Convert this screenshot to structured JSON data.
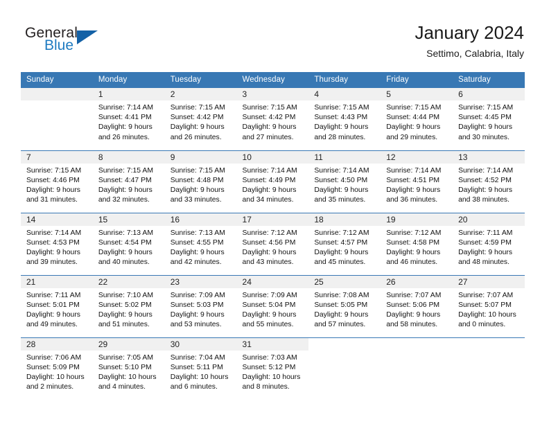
{
  "brand": {
    "name_part1": "General",
    "name_part2": "Blue",
    "flag_icon": "triangle-flag-icon",
    "accent_color": "#1f7bc1",
    "flag_color": "#1461a6"
  },
  "header": {
    "title": "January 2024",
    "subtitle": "Settimo, Calabria, Italy"
  },
  "calendar": {
    "header_bg": "#3878b4",
    "daynum_bg": "#f0f0f0",
    "weekdays": [
      "Sunday",
      "Monday",
      "Tuesday",
      "Wednesday",
      "Thursday",
      "Friday",
      "Saturday"
    ],
    "weeks": [
      [
        {
          "day": "",
          "sunrise": "",
          "sunset": "",
          "daylight_line1": "",
          "daylight_line2": "",
          "empty": true
        },
        {
          "day": "1",
          "sunrise": "Sunrise: 7:14 AM",
          "sunset": "Sunset: 4:41 PM",
          "daylight_line1": "Daylight: 9 hours",
          "daylight_line2": "and 26 minutes."
        },
        {
          "day": "2",
          "sunrise": "Sunrise: 7:15 AM",
          "sunset": "Sunset: 4:42 PM",
          "daylight_line1": "Daylight: 9 hours",
          "daylight_line2": "and 26 minutes."
        },
        {
          "day": "3",
          "sunrise": "Sunrise: 7:15 AM",
          "sunset": "Sunset: 4:42 PM",
          "daylight_line1": "Daylight: 9 hours",
          "daylight_line2": "and 27 minutes."
        },
        {
          "day": "4",
          "sunrise": "Sunrise: 7:15 AM",
          "sunset": "Sunset: 4:43 PM",
          "daylight_line1": "Daylight: 9 hours",
          "daylight_line2": "and 28 minutes."
        },
        {
          "day": "5",
          "sunrise": "Sunrise: 7:15 AM",
          "sunset": "Sunset: 4:44 PM",
          "daylight_line1": "Daylight: 9 hours",
          "daylight_line2": "and 29 minutes."
        },
        {
          "day": "6",
          "sunrise": "Sunrise: 7:15 AM",
          "sunset": "Sunset: 4:45 PM",
          "daylight_line1": "Daylight: 9 hours",
          "daylight_line2": "and 30 minutes."
        }
      ],
      [
        {
          "day": "7",
          "sunrise": "Sunrise: 7:15 AM",
          "sunset": "Sunset: 4:46 PM",
          "daylight_line1": "Daylight: 9 hours",
          "daylight_line2": "and 31 minutes."
        },
        {
          "day": "8",
          "sunrise": "Sunrise: 7:15 AM",
          "sunset": "Sunset: 4:47 PM",
          "daylight_line1": "Daylight: 9 hours",
          "daylight_line2": "and 32 minutes."
        },
        {
          "day": "9",
          "sunrise": "Sunrise: 7:15 AM",
          "sunset": "Sunset: 4:48 PM",
          "daylight_line1": "Daylight: 9 hours",
          "daylight_line2": "and 33 minutes."
        },
        {
          "day": "10",
          "sunrise": "Sunrise: 7:14 AM",
          "sunset": "Sunset: 4:49 PM",
          "daylight_line1": "Daylight: 9 hours",
          "daylight_line2": "and 34 minutes."
        },
        {
          "day": "11",
          "sunrise": "Sunrise: 7:14 AM",
          "sunset": "Sunset: 4:50 PM",
          "daylight_line1": "Daylight: 9 hours",
          "daylight_line2": "and 35 minutes."
        },
        {
          "day": "12",
          "sunrise": "Sunrise: 7:14 AM",
          "sunset": "Sunset: 4:51 PM",
          "daylight_line1": "Daylight: 9 hours",
          "daylight_line2": "and 36 minutes."
        },
        {
          "day": "13",
          "sunrise": "Sunrise: 7:14 AM",
          "sunset": "Sunset: 4:52 PM",
          "daylight_line1": "Daylight: 9 hours",
          "daylight_line2": "and 38 minutes."
        }
      ],
      [
        {
          "day": "14",
          "sunrise": "Sunrise: 7:14 AM",
          "sunset": "Sunset: 4:53 PM",
          "daylight_line1": "Daylight: 9 hours",
          "daylight_line2": "and 39 minutes."
        },
        {
          "day": "15",
          "sunrise": "Sunrise: 7:13 AM",
          "sunset": "Sunset: 4:54 PM",
          "daylight_line1": "Daylight: 9 hours",
          "daylight_line2": "and 40 minutes."
        },
        {
          "day": "16",
          "sunrise": "Sunrise: 7:13 AM",
          "sunset": "Sunset: 4:55 PM",
          "daylight_line1": "Daylight: 9 hours",
          "daylight_line2": "and 42 minutes."
        },
        {
          "day": "17",
          "sunrise": "Sunrise: 7:12 AM",
          "sunset": "Sunset: 4:56 PM",
          "daylight_line1": "Daylight: 9 hours",
          "daylight_line2": "and 43 minutes."
        },
        {
          "day": "18",
          "sunrise": "Sunrise: 7:12 AM",
          "sunset": "Sunset: 4:57 PM",
          "daylight_line1": "Daylight: 9 hours",
          "daylight_line2": "and 45 minutes."
        },
        {
          "day": "19",
          "sunrise": "Sunrise: 7:12 AM",
          "sunset": "Sunset: 4:58 PM",
          "daylight_line1": "Daylight: 9 hours",
          "daylight_line2": "and 46 minutes."
        },
        {
          "day": "20",
          "sunrise": "Sunrise: 7:11 AM",
          "sunset": "Sunset: 4:59 PM",
          "daylight_line1": "Daylight: 9 hours",
          "daylight_line2": "and 48 minutes."
        }
      ],
      [
        {
          "day": "21",
          "sunrise": "Sunrise: 7:11 AM",
          "sunset": "Sunset: 5:01 PM",
          "daylight_line1": "Daylight: 9 hours",
          "daylight_line2": "and 49 minutes."
        },
        {
          "day": "22",
          "sunrise": "Sunrise: 7:10 AM",
          "sunset": "Sunset: 5:02 PM",
          "daylight_line1": "Daylight: 9 hours",
          "daylight_line2": "and 51 minutes."
        },
        {
          "day": "23",
          "sunrise": "Sunrise: 7:09 AM",
          "sunset": "Sunset: 5:03 PM",
          "daylight_line1": "Daylight: 9 hours",
          "daylight_line2": "and 53 minutes."
        },
        {
          "day": "24",
          "sunrise": "Sunrise: 7:09 AM",
          "sunset": "Sunset: 5:04 PM",
          "daylight_line1": "Daylight: 9 hours",
          "daylight_line2": "and 55 minutes."
        },
        {
          "day": "25",
          "sunrise": "Sunrise: 7:08 AM",
          "sunset": "Sunset: 5:05 PM",
          "daylight_line1": "Daylight: 9 hours",
          "daylight_line2": "and 57 minutes."
        },
        {
          "day": "26",
          "sunrise": "Sunrise: 7:07 AM",
          "sunset": "Sunset: 5:06 PM",
          "daylight_line1": "Daylight: 9 hours",
          "daylight_line2": "and 58 minutes."
        },
        {
          "day": "27",
          "sunrise": "Sunrise: 7:07 AM",
          "sunset": "Sunset: 5:07 PM",
          "daylight_line1": "Daylight: 10 hours",
          "daylight_line2": "and 0 minutes."
        }
      ],
      [
        {
          "day": "28",
          "sunrise": "Sunrise: 7:06 AM",
          "sunset": "Sunset: 5:09 PM",
          "daylight_line1": "Daylight: 10 hours",
          "daylight_line2": "and 2 minutes."
        },
        {
          "day": "29",
          "sunrise": "Sunrise: 7:05 AM",
          "sunset": "Sunset: 5:10 PM",
          "daylight_line1": "Daylight: 10 hours",
          "daylight_line2": "and 4 minutes."
        },
        {
          "day": "30",
          "sunrise": "Sunrise: 7:04 AM",
          "sunset": "Sunset: 5:11 PM",
          "daylight_line1": "Daylight: 10 hours",
          "daylight_line2": "and 6 minutes."
        },
        {
          "day": "31",
          "sunrise": "Sunrise: 7:03 AM",
          "sunset": "Sunset: 5:12 PM",
          "daylight_line1": "Daylight: 10 hours",
          "daylight_line2": "and 8 minutes."
        },
        {
          "day": "",
          "sunrise": "",
          "sunset": "",
          "daylight_line1": "",
          "daylight_line2": "",
          "blank": true
        },
        {
          "day": "",
          "sunrise": "",
          "sunset": "",
          "daylight_line1": "",
          "daylight_line2": "",
          "blank": true
        },
        {
          "day": "",
          "sunrise": "",
          "sunset": "",
          "daylight_line1": "",
          "daylight_line2": "",
          "blank": true
        }
      ]
    ]
  }
}
